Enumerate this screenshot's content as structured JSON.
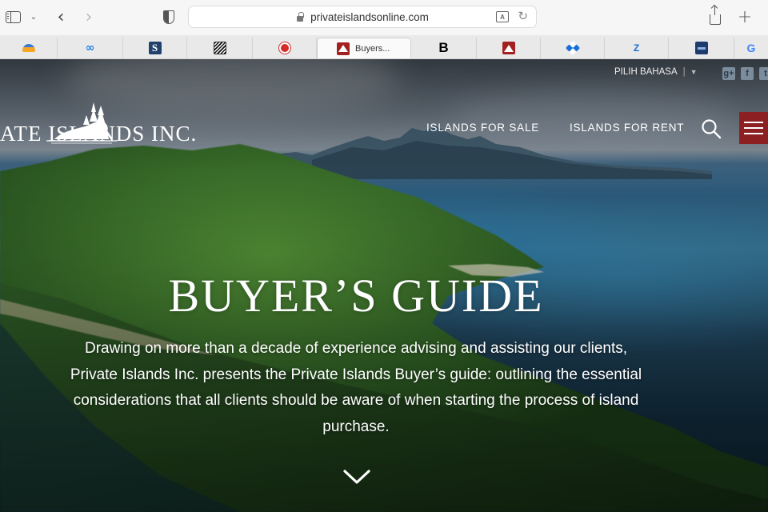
{
  "browser": {
    "url": "privateislandsonline.com",
    "translate_icon": "translate-icon",
    "reload_icon": "reload-icon"
  },
  "tabs": [
    {
      "icon": "sun-logo-icon",
      "title": ""
    },
    {
      "icon": "infinity-icon",
      "glyph": "∞",
      "title": ""
    },
    {
      "icon": "s-logo-icon",
      "glyph": "S",
      "title": ""
    },
    {
      "icon": "striped-logo-icon",
      "title": ""
    },
    {
      "icon": "red-circle-logo-icon",
      "title": ""
    },
    {
      "icon": "private-islands-logo-icon",
      "title": "Buyers...",
      "active": true
    },
    {
      "icon": "b-logo-icon",
      "glyph": "B",
      "title": ""
    },
    {
      "icon": "private-islands-logo-icon",
      "title": ""
    },
    {
      "icon": "blue-pixel-logo-icon",
      "title": ""
    },
    {
      "icon": "z-logo-icon",
      "glyph": "Z",
      "title": ""
    },
    {
      "icon": "navy-logo-icon",
      "title": ""
    },
    {
      "icon": "google-logo-icon",
      "glyph": "G",
      "title": ""
    }
  ],
  "site": {
    "logo_text": "ATE ISLANDS INC.",
    "language": "PILIH BAHASA",
    "social": [
      {
        "icon": "google-plus-icon",
        "glyph": "g+"
      },
      {
        "icon": "facebook-icon",
        "glyph": "f"
      },
      {
        "icon": "twitter-icon",
        "glyph": "t"
      }
    ],
    "nav": {
      "islands_for_sale": "ISLANDS FOR SALE",
      "islands_for_rent": "ISLANDS FOR RENT"
    }
  },
  "hero": {
    "title": "BUYER’S GUIDE",
    "description_lines": [
      "Drawing on more than a decade of experience advising and assisting our clients,",
      "Private Islands Inc. presents the Private Islands Buyer’s guide: outlining the essential",
      "considerations that all clients should be aware of when starting the process of island",
      "purchase."
    ]
  },
  "colors": {
    "menu_button": "#8c1f22",
    "tab_active": "#fafafa",
    "hero_text": "#ffffff"
  }
}
